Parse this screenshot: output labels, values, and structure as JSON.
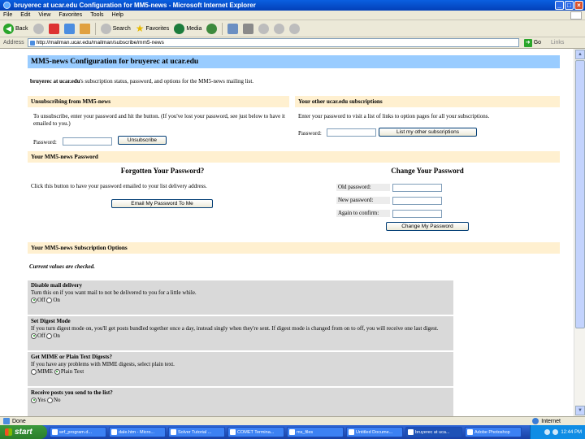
{
  "window": {
    "title": "bruyerec at ucar.edu Configuration for MM5-news - Microsoft Internet Explorer",
    "controls": [
      "_",
      "□",
      "×"
    ]
  },
  "menu": [
    "File",
    "Edit",
    "View",
    "Favorites",
    "Tools",
    "Help"
  ],
  "toolbar": {
    "back": "Back",
    "search": "Search",
    "favorites": "Favorites",
    "media": "Media"
  },
  "address": {
    "label": "Address",
    "url": "http://mailman.ucar.edu/mailman/subscribe/mm5-news",
    "go": "Go",
    "links": "Links"
  },
  "page": {
    "header": "MM5-news Configuration for bruyerec at ucar.edu",
    "intro_bold": "bruyerec at ucar.edu",
    "intro_rest": "'s subscription status, password, and options for the MM5-news mailing list.",
    "unsubscribe": {
      "title": "Unsubscribing from MM5-news",
      "text": "To unsubscribe, enter your password and hit the button. (If you've lost your password, see just below to have it emailed to you.)",
      "password_label": "Password:",
      "button": "Unsubscribe"
    },
    "other": {
      "title": "Your other ucar.edu subscriptions",
      "text": "Enter your password to visit a list of links to option pages for all your subscriptions.",
      "password_label": "Password:",
      "button": "List my other subscriptions"
    },
    "password_section": {
      "title": "Your MM5-news Password",
      "forgotten_title": "Forgotten Your Password?",
      "forgotten_text": "Click this button to have your password emailed to your list delivery address.",
      "email_button": "Email My Password To Me",
      "change_title": "Change Your Password",
      "old_label": "Old password:",
      "new_label": "New password:",
      "again_label": "Again to confirm:",
      "change_button": "Change My Password"
    },
    "options_section": {
      "title": "Your MM5-news Subscription Options",
      "note": "Current values are checked.",
      "options": [
        {
          "title": "Disable mail delivery",
          "desc": "Turn this on if you want mail to not be delivered to you for a little while.",
          "choices": [
            "Off",
            "On"
          ],
          "selected": 0
        },
        {
          "title": "Set Digest Mode",
          "desc": "If you turn digest mode on, you'll get posts bundled together once a day, instead singly when they're sent. If digest mode is changed from on to off, you will receive one last digest.",
          "choices": [
            "Off",
            "On"
          ],
          "selected": 0
        },
        {
          "title": "Get MIME or Plain Text Digests?",
          "desc": "If you have any problems with MIME digests, select plain text.",
          "choices": [
            "MIME",
            "Plain Text"
          ],
          "selected": 1
        },
        {
          "title": "Receive posts you send to the list?",
          "desc": "",
          "choices": [
            "Yes",
            "No"
          ],
          "selected": 0
        }
      ]
    }
  },
  "status": {
    "text": "Done",
    "zone": "Internet"
  },
  "taskbar": {
    "start": "start",
    "tasks": [
      "wrf_program.d...",
      "dale.htm - Micro...",
      "Solver Tutorial ...",
      "COMET Termina...",
      "ms_files",
      "Untitled Docume...",
      "bruyerec at uca...",
      "Adobe Photoshop"
    ],
    "active_index": 6,
    "clock": "12:44 PM"
  }
}
